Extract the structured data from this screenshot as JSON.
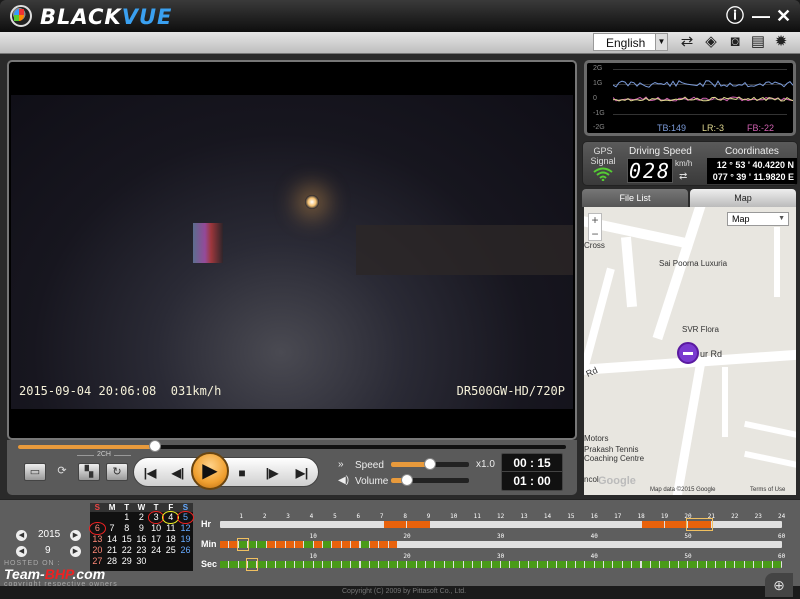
{
  "app": {
    "title_black": "BLACK",
    "title_blue": "VUE",
    "info_icon": "ⓘ",
    "minimize": "—",
    "close": "✕"
  },
  "toolbar": {
    "language": "English",
    "icons": [
      "repeat-icon",
      "compass-icon",
      "camera-icon",
      "print-icon",
      "gear-icon"
    ]
  },
  "video": {
    "osd_left": "2015-09-04 20:06:08  031km/h",
    "osd_right": "DR500GW-HD/720P",
    "seek_progress": 0.25
  },
  "controls": {
    "ch_label": "2CH",
    "speed_label": "Speed",
    "speed_value": "x1.0",
    "speed_level": 0.5,
    "volume_label": "Volume",
    "volume_level": 0.2,
    "current_time": "00 : 15",
    "total_time": "01 : 00"
  },
  "gsensor": {
    "labels": [
      "2G",
      "1G",
      "0",
      "-1G",
      "-2G"
    ],
    "tb": "TB:149",
    "lr": "LR:-3",
    "fb": "FB:-22",
    "colors": {
      "tb": "#7a9ad8",
      "lr": "#e0d890",
      "fb": "#d060b0"
    }
  },
  "gps": {
    "signal_label": "GPS Signal",
    "speed_label": "Driving Speed",
    "speed": "028",
    "unit": "km/h",
    "coord_label": "Coordinates",
    "lat": "12 ° 53 ' 40.4220 N",
    "lon": "077 ° 39 ' 11.9820 E"
  },
  "tabs": {
    "file_list": "File List",
    "map": "Map"
  },
  "map": {
    "type": "Map",
    "labels": {
      "cross": "Cross",
      "sai": "Sai Poorna Luxuria",
      "svr": "SVR Flora",
      "ur_rd": "ur Rd",
      "rd": "Rd",
      "motors": "Motors",
      "prakash": "Prakash Tennis",
      "coaching": "Coaching Centre",
      "ncol": "ncol",
      "google": "Google",
      "mapdata": "Map data ©2015 Google",
      "terms": "Terms of Use"
    }
  },
  "date": {
    "year": "2015",
    "month": "9"
  },
  "calendar": {
    "weekdays": [
      "S",
      "M",
      "T",
      "W",
      "T",
      "F",
      "S"
    ],
    "weeks": [
      [
        "",
        "",
        "1",
        "2",
        "3",
        "4",
        "5"
      ],
      [
        "6",
        "7",
        "8",
        "9",
        "10",
        "11",
        "12"
      ],
      [
        "13",
        "14",
        "15",
        "16",
        "17",
        "18",
        "19"
      ],
      [
        "20",
        "21",
        "22",
        "23",
        "24",
        "25",
        "26"
      ],
      [
        "27",
        "28",
        "29",
        "30",
        "",
        "",
        ""
      ]
    ],
    "selected_day": "4",
    "recorded_days": [
      "3",
      "5",
      "6"
    ]
  },
  "timeline": {
    "hr_label": "Hr",
    "min_label": "Min",
    "sec_label": "Sec",
    "hr_ticks": [
      "1",
      "2",
      "3",
      "4",
      "5",
      "6",
      "7",
      "8",
      "9",
      "10",
      "11",
      "12",
      "13",
      "14",
      "15",
      "16",
      "17",
      "18",
      "19",
      "20",
      "21",
      "22",
      "23",
      "24"
    ],
    "min_ticks": [
      "10",
      "20",
      "30",
      "40",
      "50",
      "60"
    ],
    "sec_ticks": [
      "10",
      "20",
      "30",
      "40",
      "50",
      "60"
    ],
    "selected_hour": 20,
    "selected_min": 2,
    "selected_sec": 3
  },
  "watermark": {
    "host": "HOSTED ON :",
    "brand_a": "Team-",
    "brand_b": "BHP",
    "brand_c": ".com",
    "copy": "copyright respective owners"
  },
  "footer": {
    "copyright": "Copyright (C) 2009 by Pittasoft Co., Ltd."
  }
}
